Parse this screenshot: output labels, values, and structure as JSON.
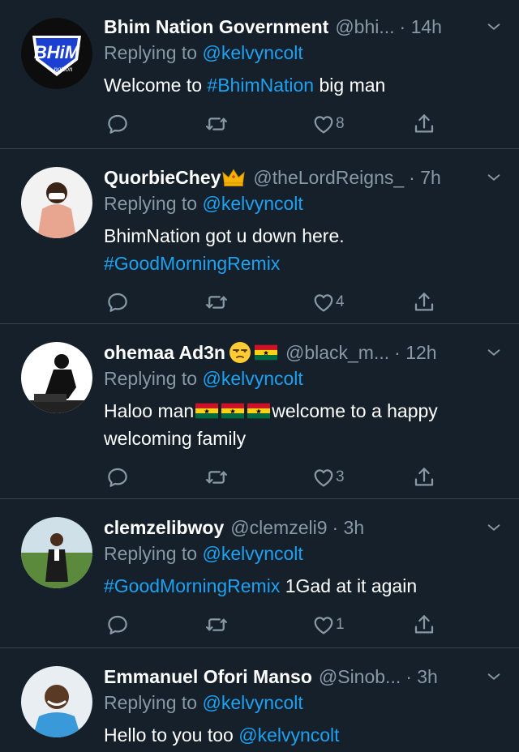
{
  "tweets": [
    {
      "name": "Bhim Nation Government",
      "handle": "@bhi...",
      "time": "· 14h",
      "reply_prefix": "Replying to",
      "reply_to": "@kelvyncolt",
      "text_pre": "Welcome to ",
      "hashtag": "#BhimNation",
      "text_post": " big man",
      "likes": "8",
      "avatar_logo_text": "BHiM",
      "avatar_logo_sub": "nation"
    },
    {
      "name": "QuorbieChey",
      "handle": "@theLordReigns_",
      "time": "· 7h",
      "reply_prefix": "Replying to",
      "reply_to": "@kelvyncolt",
      "text": "BhimNation got u down here.",
      "hashtag": "#GoodMorningRemix",
      "likes": "4"
    },
    {
      "name": "ohemaa Ad3n",
      "handle": "@black_m...",
      "time": "· 12h",
      "reply_prefix": "Replying to",
      "reply_to": "@kelvyncolt",
      "text_pre": "Haloo man",
      "text_post": "welcome to a happy",
      "text_line2": "welcoming family",
      "likes": "3"
    },
    {
      "name": "clemzelibwoy",
      "handle": "@clemzeli9",
      "time": "· 3h",
      "reply_prefix": "Replying to",
      "reply_to": "@kelvyncolt",
      "hashtag": "#GoodMorningRemix",
      "text_post": " 1Gad at it again",
      "likes": "1"
    },
    {
      "name": "Emmanuel Ofori Manso",
      "handle": "@Sinob...",
      "time": "· 3h",
      "reply_prefix": "Replying to",
      "reply_to": "@kelvyncolt",
      "text_pre": "Hello to you too ",
      "mention": "@kelvyncolt"
    }
  ],
  "colors": {
    "background": "#15202b",
    "link": "#1da1f2",
    "muted": "#8899a6",
    "divider": "#38444d"
  },
  "icons": [
    "reply-icon",
    "retweet-icon",
    "like-icon",
    "share-icon",
    "chevron-down-icon",
    "crown-emoji",
    "ghana-flag-emoji",
    "unamused-face-emoji"
  ]
}
